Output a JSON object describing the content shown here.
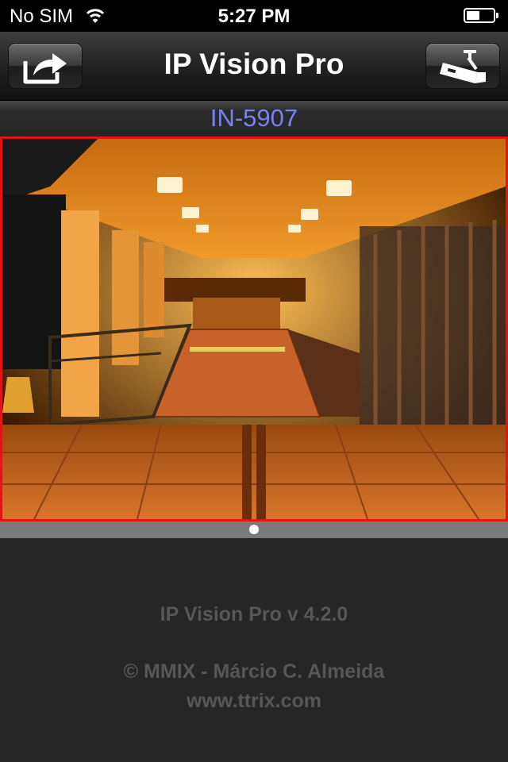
{
  "status_bar": {
    "carrier": "No SIM",
    "time": "5:27 PM",
    "wifi_icon": "wifi-icon",
    "battery_icon": "battery-icon"
  },
  "nav": {
    "title": "IP Vision Pro",
    "left_button_icon": "share-icon",
    "right_button_icon": "security-camera-icon"
  },
  "camera": {
    "name": "IN-5907",
    "border_color": "#e11515",
    "feed_description_icon": "camera-feed"
  },
  "pager": {
    "pages": 1,
    "current": 1
  },
  "info": {
    "version": "IP Vision Pro v 4.2.0",
    "copyright": "© MMIX - Márcio C. Almeida",
    "website": "www.ttrix.com"
  },
  "colors": {
    "camera_name": "#7a82f0",
    "info_text": "#575757",
    "background": "#262626"
  }
}
